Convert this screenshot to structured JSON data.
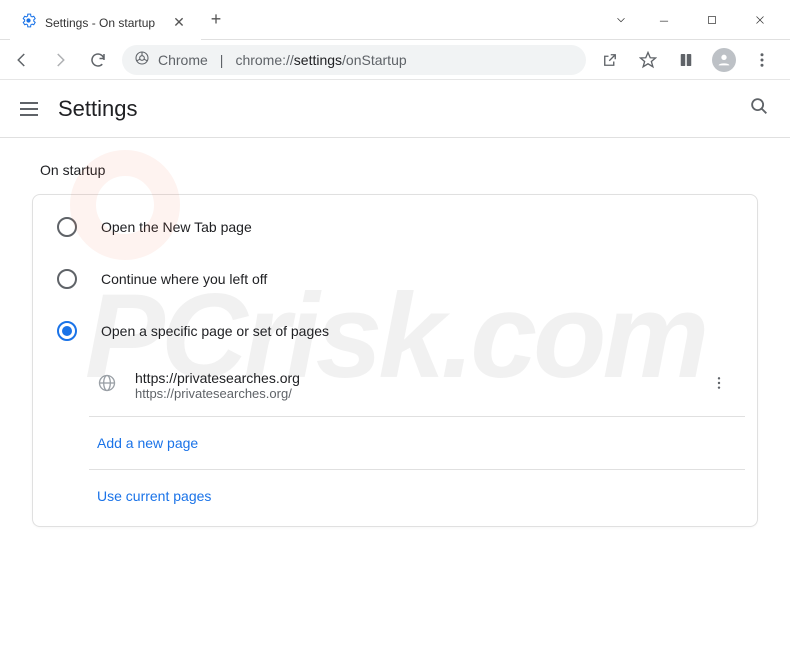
{
  "window": {
    "tab_title": "Settings - On startup"
  },
  "addressbar": {
    "label": "Chrome",
    "url_prefix": "chrome://",
    "url_bold": "settings",
    "url_suffix": "/onStartup"
  },
  "header": {
    "title": "Settings"
  },
  "section": {
    "title": "On startup",
    "options": [
      {
        "label": "Open the New Tab page",
        "selected": false
      },
      {
        "label": "Continue where you left off",
        "selected": false
      },
      {
        "label": "Open a specific page or set of pages",
        "selected": true
      }
    ],
    "page_entry": {
      "title": "https://privatesearches.org",
      "url": "https://privatesearches.org/"
    },
    "add_page_label": "Add a new page",
    "use_current_label": "Use current pages"
  }
}
